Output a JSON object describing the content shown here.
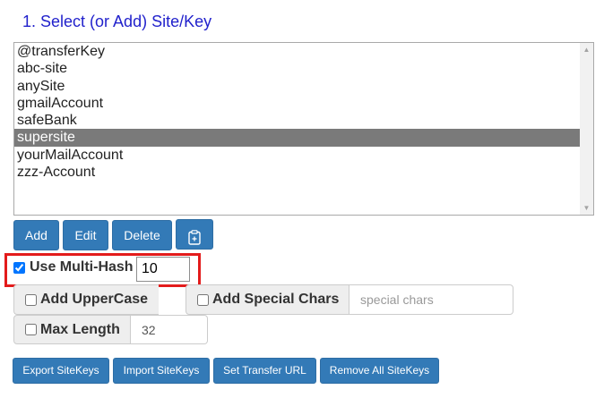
{
  "heading": "1. Select (or Add) Site/Key",
  "sitekeys": [
    {
      "label": "@transferKey",
      "selected": false
    },
    {
      "label": "abc-site",
      "selected": false
    },
    {
      "label": "anySite",
      "selected": false
    },
    {
      "label": "gmailAccount",
      "selected": false
    },
    {
      "label": "safeBank",
      "selected": false
    },
    {
      "label": "supersite",
      "selected": true
    },
    {
      "label": "yourMailAccount",
      "selected": false
    },
    {
      "label": "zzz-Account",
      "selected": false
    }
  ],
  "buttons": {
    "add": "Add",
    "edit": "Edit",
    "delete": "Delete",
    "clipboard_icon": "clipboard-plus-icon"
  },
  "options": {
    "multi_hash_label": "Use Multi-Hash",
    "multi_hash_checked": true,
    "multi_hash_value": "10",
    "uppercase_label": "Add UpperCase",
    "uppercase_checked": false,
    "special_label": "Add Special Chars",
    "special_checked": false,
    "special_placeholder": "special chars",
    "maxlength_label": "Max Length",
    "maxlength_checked": false,
    "maxlength_value": "32"
  },
  "actions": {
    "export": "Export SiteKeys",
    "import": "Import SiteKeys",
    "transfer": "Set Transfer URL",
    "remove_all": "Remove All SiteKeys"
  },
  "colors": {
    "heading": "#2222cc",
    "button": "#337ab7",
    "selected_row": "#7a7a7a",
    "highlight_box": "#e31b1b"
  }
}
